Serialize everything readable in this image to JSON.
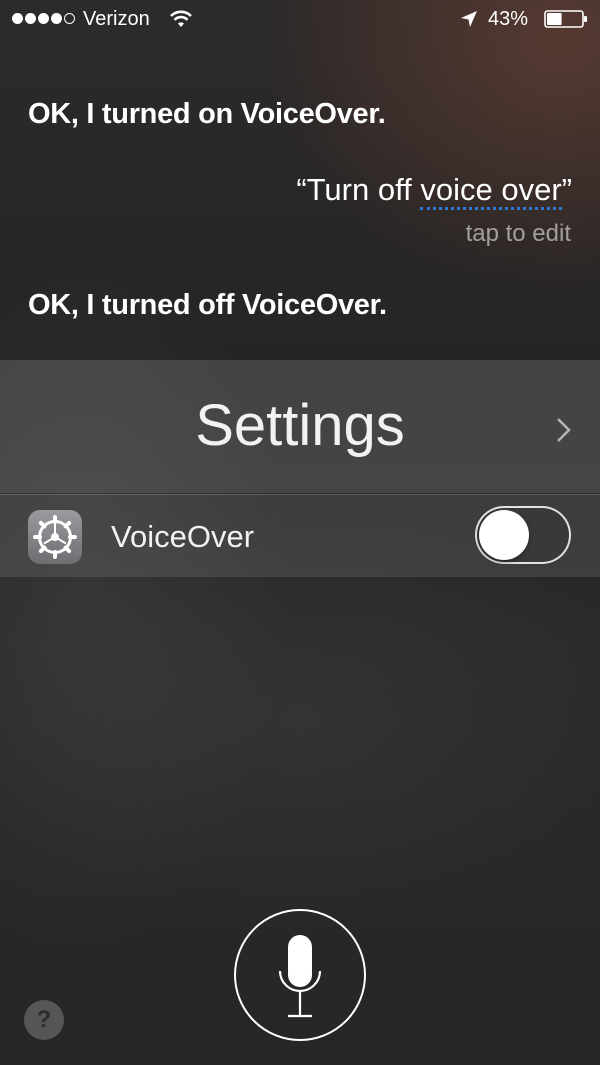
{
  "status_bar": {
    "signal_icon": "signal-dots-icon",
    "signal_bars_filled": 4,
    "signal_bars_total": 5,
    "carrier": "Verizon",
    "wifi_icon": "wifi-icon",
    "location_icon": "location-arrow-icon",
    "battery_percent": "43%",
    "battery_level": 0.43,
    "battery_icon": "battery-icon"
  },
  "conversation": {
    "siri_response_1": "OK, I turned on VoiceOver.",
    "user_quote_prefix": "“Turn off ",
    "user_quote_highlight": "voice over",
    "user_quote_suffix": "”",
    "tap_to_edit": "tap to edit",
    "siri_response_2": "OK, I turned off VoiceOver."
  },
  "settings_card": {
    "title": "Settings",
    "chevron_icon": "chevron-right-icon",
    "row": {
      "icon": "settings-gear-icon",
      "label": "VoiceOver",
      "toggle_on": false
    }
  },
  "controls": {
    "mic_icon": "microphone-icon",
    "help_label": "?",
    "highlight_color": "#2a7bd8"
  }
}
